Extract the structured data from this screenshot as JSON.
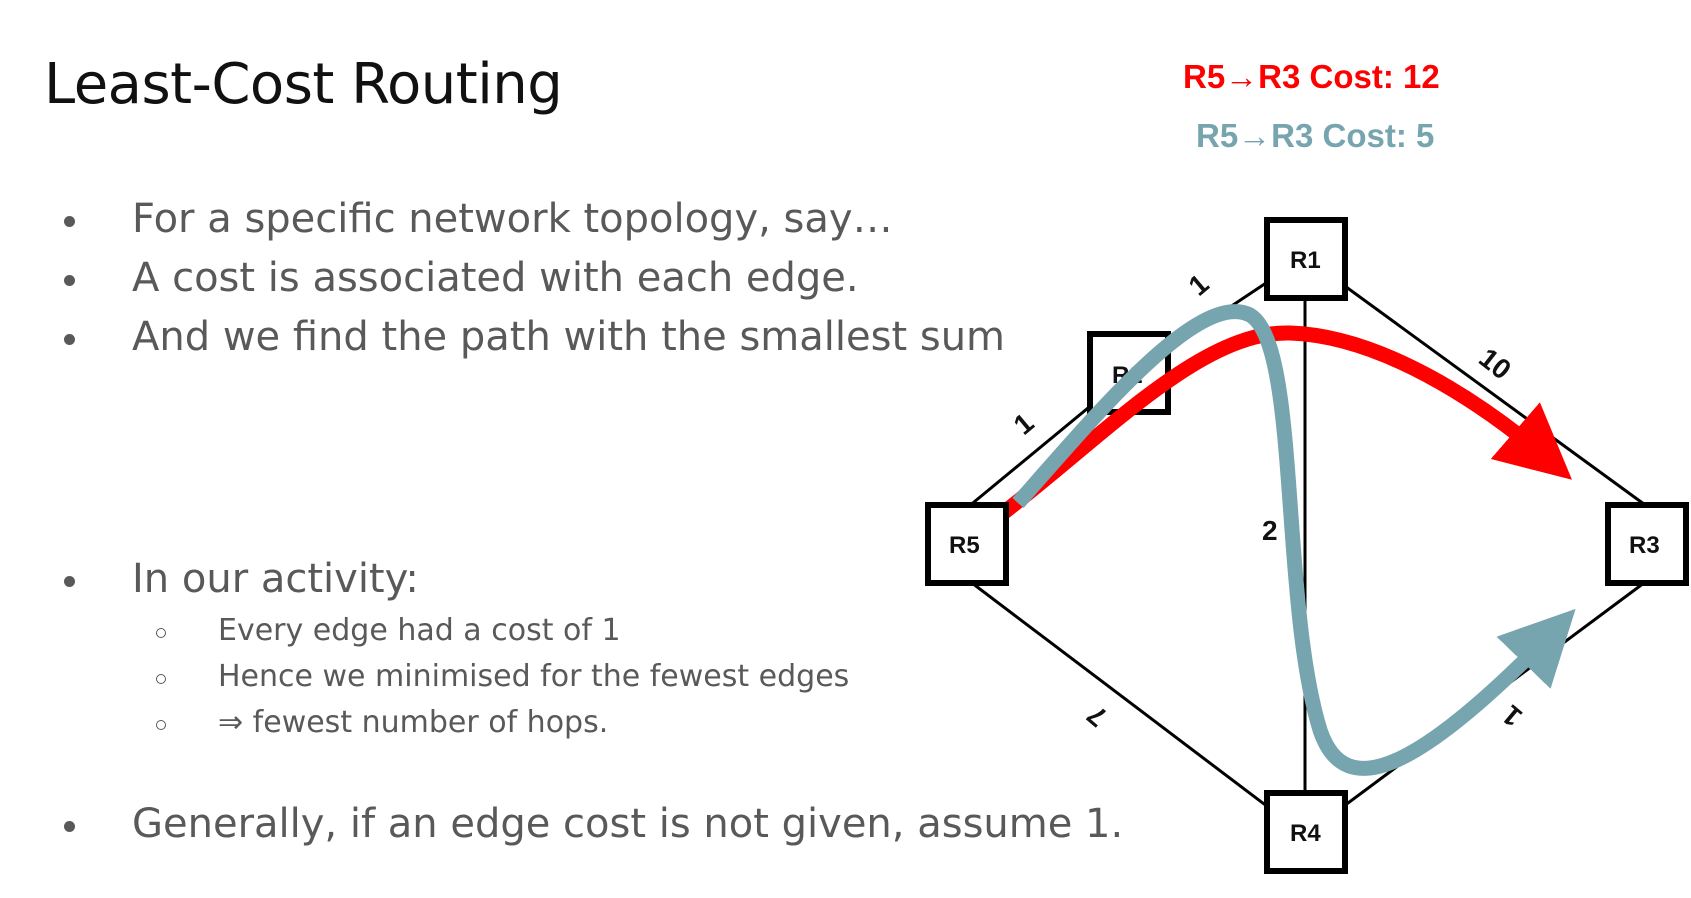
{
  "slide": {
    "title": "Least-Cost Routing",
    "bullets_top": [
      "For a specific network topology, say…",
      "A cost is associated with each edge.",
      "And we find the path with the smallest sum"
    ],
    "bullet_activity": "In our activity:",
    "sub_bullets": [
      "Every edge had a cost of 1",
      "Hence we minimised for the fewest edges",
      "⇒ fewest number of hops."
    ],
    "bullet_general": "Generally, if an edge cost is not given, assume 1."
  },
  "costs": {
    "red_label": "R5→R3 Cost: 12",
    "blue_label": "R5→R3 Cost: 5",
    "red_color": "#ff0000",
    "blue_color": "#76a5af"
  },
  "routers": {
    "r1": "R1",
    "r2": "R2",
    "r3": "R3",
    "r4": "R4",
    "r5": "R5"
  },
  "edge_costs": {
    "r5_r2": "1",
    "r2_r1": "1",
    "r1_r3": "10",
    "r1_r4": "2",
    "r5_r4": "7",
    "r4_r3": "1"
  }
}
